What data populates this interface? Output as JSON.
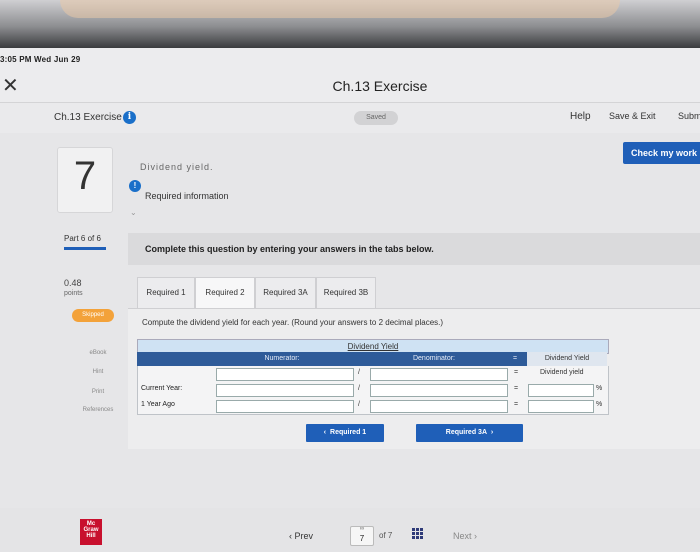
{
  "status_bar": {
    "time_date": "3:05 PM  Wed Jun 29"
  },
  "title_bar": {
    "title": "Ch.13 Exercise",
    "close_symbol": "✕"
  },
  "header": {
    "exercise_label": "Ch.13 Exercise",
    "info_glyph": "i",
    "saved_label": "Saved",
    "help_label": "Help",
    "save_exit_label": "Save & Exit",
    "submit_label": "Subm",
    "check_work_label": "Check my work"
  },
  "question": {
    "number": "7",
    "cut_text": "Dividend yield.",
    "required_info_label": "Required information",
    "part_label": "Part 6 of 6",
    "points_value": "0.48",
    "points_label": "points",
    "status_badge": "Skipped"
  },
  "side_links": [
    "eBook",
    "Hint",
    "Print",
    "References"
  ],
  "directions": "Complete this question by entering your answers in the tabs below.",
  "tabs": [
    {
      "label": "Required 1"
    },
    {
      "label": "Required 2"
    },
    {
      "label": "Required 3A"
    },
    {
      "label": "Required 3B"
    }
  ],
  "instruction": "Compute the dividend yield for each year. (Round your answers to 2 decimal places.)",
  "table": {
    "title": "Dividend Yield",
    "headers": {
      "numerator": "Numerator:",
      "denominator": "Denominator:",
      "result": "Dividend Yield"
    },
    "sub_result": "Dividend yield",
    "divide_symbol": "/",
    "equals_symbol": "=",
    "percent_symbol": "%",
    "rows": [
      {
        "label": "Current Year:"
      },
      {
        "label": "1 Year Ago"
      }
    ]
  },
  "nav_buttons": {
    "prev_label": "Required 1",
    "next_label": "Required 3A"
  },
  "footer": {
    "logo_text": [
      "Mc",
      "Graw",
      "Hill"
    ],
    "prev_label": "Prev",
    "page_current": "7",
    "page_of": "of 7",
    "next_label": "Next"
  },
  "colors": {
    "primary_blue": "#1f5fb8",
    "header_navy": "#2e5b99",
    "skipped_orange": "#f3a23a",
    "logo_red": "#c8102e"
  }
}
